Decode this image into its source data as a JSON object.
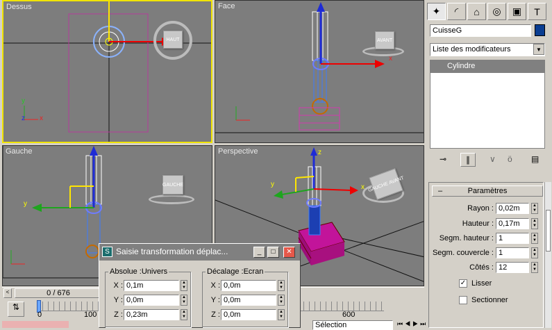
{
  "viewports": {
    "top": "Dessus",
    "front": "Face",
    "left": "Gauche",
    "persp": "Perspective"
  },
  "viewcube": {
    "top": "HAUT",
    "front": "AVANT",
    "left": "GAUCHE",
    "persp_a": "GAUCHE",
    "persp_b": "AVANT"
  },
  "axes": {
    "x": "x",
    "y": "y",
    "z": "z"
  },
  "panel": {
    "object_name": "CuisseG",
    "object_color": "#0a3d91",
    "modifier_list": "Liste des modificateurs",
    "stack_item": "Cylindre",
    "rollout": "Paramètres",
    "params": [
      {
        "label": "Rayon :",
        "value": "0,02m"
      },
      {
        "label": "Hauteur :",
        "value": "0,17m"
      },
      {
        "label": "Segm. hauteur :",
        "value": "1"
      },
      {
        "label": "Segm. couvercle :",
        "value": "1"
      },
      {
        "label": "Côtés :",
        "value": "12"
      }
    ],
    "smooth": "Lisser",
    "slice": "Sectionner",
    "minus": "–"
  },
  "timeline": {
    "frame": "0 / 676",
    "tick_left": "0",
    "tick_mid": "100",
    "tick_right": "600",
    "selection": "Sélection"
  },
  "dialog": {
    "title": "Saisie transformation déplac...",
    "absolute": "Absolue :Univers",
    "offset": "Décalage :Ecran",
    "abs": [
      {
        "axis": "X :",
        "value": "0,1m"
      },
      {
        "axis": "Y :",
        "value": "0,0m"
      },
      {
        "axis": "Z :",
        "value": "0,23m"
      }
    ],
    "off": [
      {
        "axis": "X :",
        "value": "0,0m"
      },
      {
        "axis": "Y :",
        "value": "0,0m"
      },
      {
        "axis": "Z :",
        "value": "0,0m"
      }
    ]
  }
}
